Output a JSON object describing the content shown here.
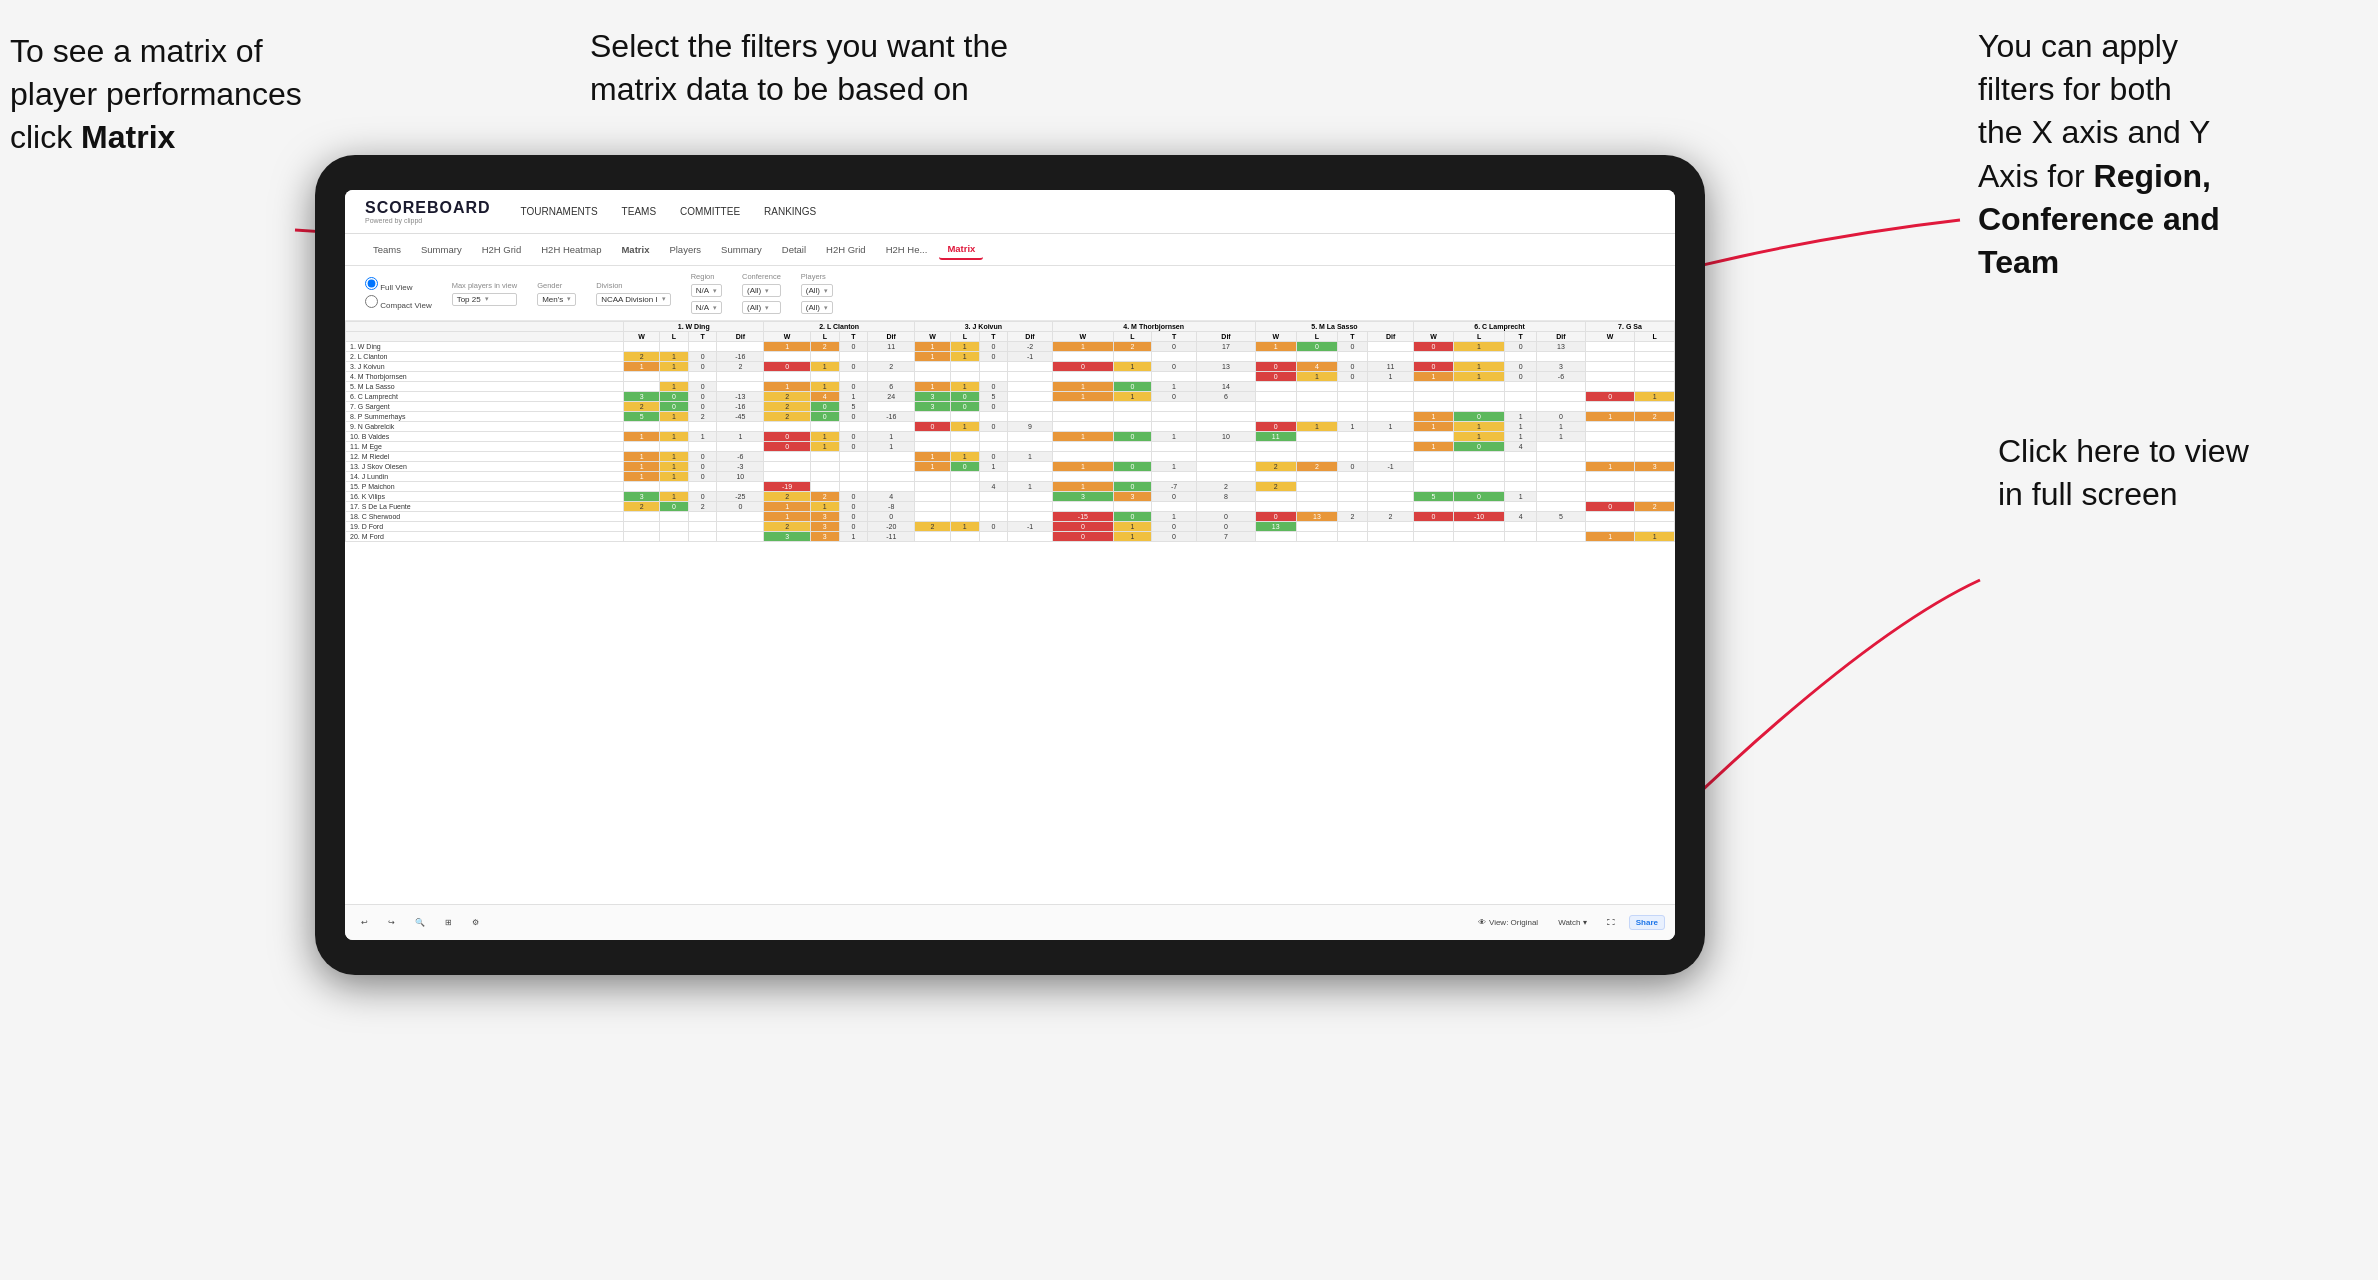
{
  "annotations": {
    "topleft": {
      "line1": "To see a matrix of",
      "line2": "player performances",
      "line3_plain": "click ",
      "line3_bold": "Matrix"
    },
    "topmid": {
      "text": "Select the filters you want the matrix data to be based on"
    },
    "topright": {
      "line1": "You  can apply",
      "line2": "filters for both",
      "line3": "the X axis and Y",
      "line4_plain": "Axis for ",
      "line4_bold": "Region,",
      "line5_bold": "Conference and",
      "line6_bold": "Team"
    },
    "bottomright": {
      "line1": "Click here to view",
      "line2": "in full screen"
    }
  },
  "app": {
    "logo": "SCOREBOARD",
    "logo_sub": "Powered by clippd",
    "nav": [
      "TOURNAMENTS",
      "TEAMS",
      "COMMITTEE",
      "RANKINGS"
    ],
    "subnav": [
      "Teams",
      "Summary",
      "H2H Grid",
      "H2H Heatmap",
      "Matrix",
      "Players",
      "Summary",
      "Detail",
      "H2H Grid",
      "H2H He...",
      "Matrix"
    ],
    "active_subnav": "Matrix"
  },
  "filters": {
    "view_full": "Full View",
    "view_compact": "Compact View",
    "max_players_label": "Max players in view",
    "max_players_val": "Top 25",
    "gender_label": "Gender",
    "gender_val": "Men's",
    "division_label": "Division",
    "division_val": "NCAA Division I",
    "region_label": "Region",
    "region_val": "N/A",
    "conference_label": "Conference",
    "conference_val": "(All)",
    "players_label": "Players",
    "players_val": "(All)"
  },
  "matrix": {
    "col_headers": [
      "1. W Ding",
      "2. L Clanton",
      "3. J Koivun",
      "4. M Thorbjornsen",
      "5. M La Sasso",
      "6. C Lamprecht",
      "7. G Sa"
    ],
    "sub_headers": [
      "W",
      "L",
      "T",
      "Dif"
    ],
    "rows": [
      {
        "name": "1. W Ding",
        "cells": [
          "",
          "",
          "",
          "",
          "1",
          "2",
          "0",
          "11",
          "1",
          "1",
          "0",
          "-2",
          "1",
          "2",
          "0",
          "17",
          "1",
          "0",
          "0",
          "",
          "0",
          "1",
          "0",
          "13",
          ""
        ]
      },
      {
        "name": "2. L Clanton",
        "cells": [
          "2",
          "1",
          "0",
          "-16",
          "",
          "",
          "",
          "",
          "1",
          "1",
          "0",
          "-1",
          "",
          "",
          "",
          "",
          "",
          "",
          "",
          "",
          "",
          "",
          "",
          "",
          ""
        ]
      },
      {
        "name": "3. J Koivun",
        "cells": [
          "1",
          "1",
          "0",
          "2",
          "0",
          "1",
          "0",
          "2",
          "",
          "",
          "",
          "",
          "0",
          "1",
          "0",
          "13",
          "0",
          "4",
          "0",
          "11",
          "0",
          "1",
          "0",
          "3",
          ""
        ]
      },
      {
        "name": "4. M Thorbjornsen",
        "cells": [
          "",
          "",
          "",
          "",
          "",
          "",
          "",
          "",
          "",
          "",
          "",
          "",
          "",
          "",
          "",
          "",
          "0",
          "1",
          "0",
          "1",
          "1",
          "1",
          "0",
          "-6",
          ""
        ]
      },
      {
        "name": "5. M La Sasso",
        "cells": [
          "",
          "1",
          "0",
          "",
          "1",
          "1",
          "0",
          "6",
          "1",
          "1",
          "0",
          "",
          "1",
          "0",
          "1",
          "14",
          "",
          "",
          "",
          "",
          "",
          "",
          "",
          "",
          ""
        ]
      },
      {
        "name": "6. C Lamprecht",
        "cells": [
          "3",
          "0",
          "0",
          "-13",
          "2",
          "4",
          "1",
          "24",
          "3",
          "0",
          "5",
          "",
          "1",
          "1",
          "0",
          "6",
          "",
          "",
          "",
          "",
          "",
          "",
          "",
          "",
          "0",
          "1"
        ]
      },
      {
        "name": "7. G Sargent",
        "cells": [
          "2",
          "0",
          "0",
          "-16",
          "2",
          "0",
          "5",
          "",
          "3",
          "0",
          "0",
          "",
          "",
          "",
          "",
          "",
          "",
          "",
          "",
          "",
          "",
          "",
          "",
          "",
          ""
        ]
      },
      {
        "name": "8. P Summerhays",
        "cells": [
          "5",
          "1",
          "2",
          "-45",
          "2",
          "0",
          "0",
          "-16",
          "",
          "",
          "",
          "",
          "",
          "",
          "",
          "",
          "",
          "",
          "",
          "",
          "1",
          "0",
          "1",
          "0",
          "1",
          "2"
        ]
      },
      {
        "name": "9. N Gabrelcik",
        "cells": [
          "",
          "",
          "",
          "",
          "",
          "",
          "",
          "",
          "0",
          "1",
          "0",
          "9",
          "",
          "",
          "",
          "",
          "0",
          "1",
          "1",
          "1",
          "1",
          "1",
          "1",
          "1",
          ""
        ]
      },
      {
        "name": "10. B Valdes",
        "cells": [
          "1",
          "1",
          "1",
          "1",
          "0",
          "1",
          "0",
          "1",
          "",
          "",
          "",
          "",
          "1",
          "0",
          "1",
          "10",
          "11",
          "",
          "",
          "",
          "",
          "1",
          "1",
          "1"
        ]
      },
      {
        "name": "11. M Ege",
        "cells": [
          "",
          "",
          "",
          "",
          "0",
          "1",
          "0",
          "1",
          "",
          "",
          "",
          "",
          "",
          "",
          "",
          "",
          "",
          "",
          "",
          "",
          "1",
          "0",
          "4",
          ""
        ]
      },
      {
        "name": "12. M Riedel",
        "cells": [
          "1",
          "1",
          "0",
          "-6",
          "",
          "",
          "",
          "",
          "1",
          "1",
          "0",
          "1",
          "",
          "",
          "",
          "",
          "",
          "",
          "",
          "",
          "",
          "",
          "",
          "",
          ""
        ]
      },
      {
        "name": "13. J Skov Olesen",
        "cells": [
          "1",
          "1",
          "0",
          "-3",
          "",
          "",
          "",
          "",
          "1",
          "0",
          "1",
          "",
          "1",
          "0",
          "1",
          "",
          "2",
          "2",
          "0",
          "-1",
          "",
          "",
          "",
          "",
          "1",
          "3"
        ]
      },
      {
        "name": "14. J Lundin",
        "cells": [
          "1",
          "1",
          "0",
          "10",
          "",
          "",
          "",
          "",
          "",
          "",
          "",
          "",
          "",
          "",
          "",
          "",
          "",
          "",
          "",
          "",
          "",
          "",
          "",
          "",
          ""
        ]
      },
      {
        "name": "15. P Maichon",
        "cells": [
          "",
          "",
          "",
          "",
          "-19",
          "",
          "",
          "",
          "",
          "",
          "4",
          "1",
          "1",
          "0",
          "-7",
          "2",
          "2"
        ]
      },
      {
        "name": "16. K Vilips",
        "cells": [
          "3",
          "1",
          "0",
          "-25",
          "2",
          "2",
          "0",
          "4",
          "",
          "",
          "",
          "",
          "3",
          "3",
          "0",
          "8",
          "",
          "",
          "",
          "",
          "5",
          "0",
          "1",
          ""
        ]
      },
      {
        "name": "17. S De La Fuente",
        "cells": [
          "2",
          "0",
          "2",
          "0",
          "1",
          "1",
          "0",
          "-8",
          "",
          "",
          "",
          "",
          "",
          "",
          "",
          "",
          "",
          "",
          "",
          "",
          "",
          "",
          "",
          "",
          "0",
          "2"
        ]
      },
      {
        "name": "18. C Sherwood",
        "cells": [
          "",
          "",
          "",
          "",
          "1",
          "3",
          "0",
          "0",
          "",
          "",
          "",
          "",
          "-15",
          "0",
          "1",
          "0",
          "0",
          "13",
          "2",
          "2",
          "0",
          "-10",
          "4",
          "5"
        ]
      },
      {
        "name": "19. D Ford",
        "cells": [
          "",
          "",
          "",
          "",
          "2",
          "3",
          "0",
          "-20",
          "2",
          "1",
          "0",
          "-1",
          "0",
          "1",
          "0",
          "0",
          "13",
          "",
          "",
          "",
          "",
          ""
        ]
      },
      {
        "name": "20. M Ford",
        "cells": [
          "",
          "",
          "",
          "",
          "3",
          "3",
          "1",
          "-11",
          "",
          "",
          "",
          "",
          "0",
          "1",
          "0",
          "7",
          "",
          "",
          "",
          "",
          "",
          "",
          "",
          "",
          "1",
          "1"
        ]
      }
    ]
  },
  "toolbar": {
    "undo": "↩",
    "redo": "↪",
    "view_label": "View: Original",
    "watch_label": "Watch ▾",
    "share_label": "Share"
  }
}
